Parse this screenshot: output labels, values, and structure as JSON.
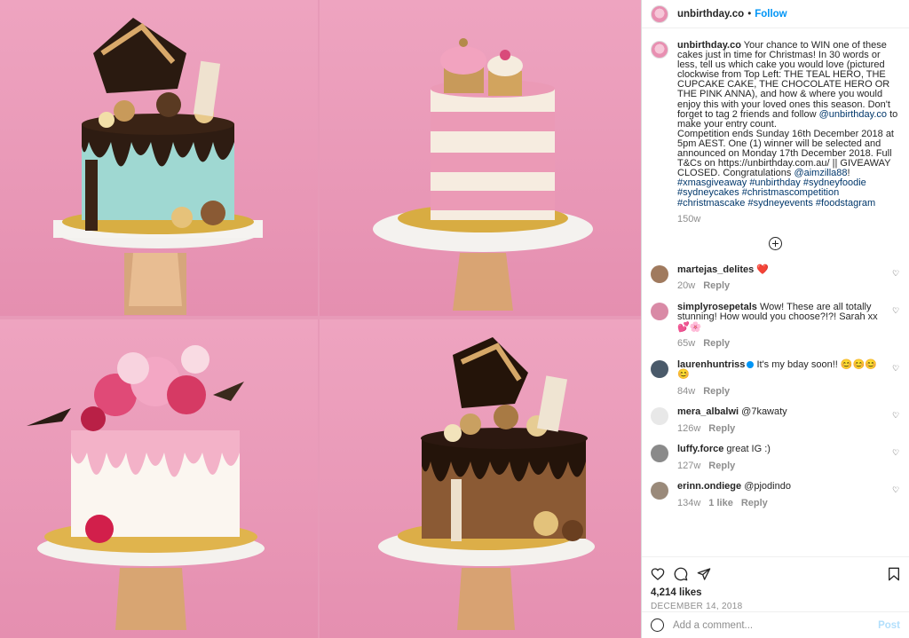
{
  "header": {
    "username": "unbirthday.co",
    "separator": "•",
    "follow_label": "Follow"
  },
  "caption": {
    "username": "unbirthday.co",
    "text_1": "Your chance to WIN one of these cakes just in time for Christmas! In 30 words or less, tell us which cake you would love (pictured clockwise from Top Left: THE TEAL HERO, THE CUPCAKE CAKE, THE CHOCOLATE HERO OR THE PINK ANNA), and how & where you would enjoy this with your loved ones this season. Don't forget to tag 2 friends and follow ",
    "mention_1": "@unbirthday.co",
    "text_2": " to make your entry count.",
    "text_3": "Competition ends Sunday 16th December 2018 at 5pm AEST. One (1) winner will be selected and announced on Monday 17th December 2018. Full T&Cs on https://unbirthday.com.au/ || GIVEAWAY CLOSED. Congratulations ",
    "mention_2": "@aimzilla88",
    "text_4": "! ",
    "hashtags": "#xmasgiveaway #unbirthday #sydneyfoodie #sydneycakes #christmascompetition #christmascake #sydneyevents #foodstagram",
    "age": "150w"
  },
  "comments": [
    {
      "username": "martejas_delites",
      "text": "❤️",
      "age": "20w",
      "likes": "",
      "reply": "Reply",
      "avatar_color": "#a07a5e"
    },
    {
      "username": "simplyrosepetals",
      "text": "Wow! These are all totally stunning! How would you choose?!?! Sarah xx💕🌸",
      "age": "65w",
      "likes": "",
      "reply": "Reply",
      "avatar_color": "#d98aa6"
    },
    {
      "username": "laurenhuntriss",
      "text": "It's my bday soon!! 😊😊😊😊",
      "age": "84w",
      "likes": "",
      "reply": "Reply",
      "avatar_color": "#4a5a6a"
    },
    {
      "username": "mera_albalwi",
      "text": "@7kawaty",
      "age": "126w",
      "likes": "",
      "reply": "Reply",
      "avatar_color": "#e8e8e8"
    },
    {
      "username": "luffy.force",
      "text": "great IG :)",
      "age": "127w",
      "likes": "",
      "reply": "Reply",
      "avatar_color": "#8a8a8a"
    },
    {
      "username": "erinn.ondiege",
      "text": "@pjodindo",
      "age": "134w",
      "likes": "1 like",
      "reply": "Reply",
      "avatar_color": "#9a8a7a"
    }
  ],
  "likes_count": "4,214 likes",
  "post_date": "DECEMBER 14, 2018",
  "add_comment": {
    "placeholder": "Add a comment...",
    "post_label": "Post"
  },
  "colors": {
    "link": "#00376b",
    "follow": "#0095f6",
    "bg_pink": "#e79ab8"
  },
  "icons": [
    "heart-icon",
    "comment-icon",
    "share-icon",
    "bookmark-icon",
    "add-comment-plus-icon",
    "emoji-icon",
    "like-heart-icon"
  ]
}
